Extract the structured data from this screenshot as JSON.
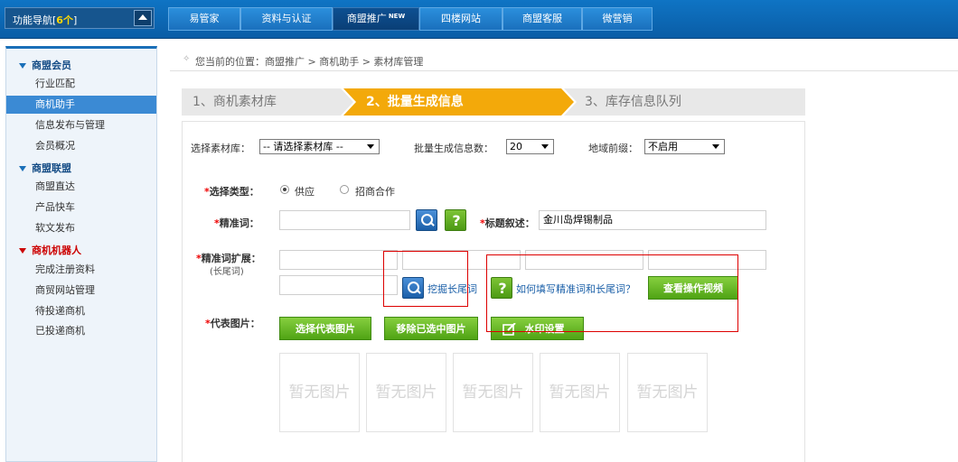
{
  "topbar": {
    "nav_select": {
      "label": "功能导航[",
      "count": "6个",
      "close": "]"
    },
    "tabs": [
      {
        "label": "易管家"
      },
      {
        "label": "资料与认证"
      },
      {
        "label": "商盟推广",
        "badge": "NEW"
      },
      {
        "label": "四楼网站"
      },
      {
        "label": "商盟客服"
      },
      {
        "label": "微营销"
      }
    ]
  },
  "sidebar": {
    "sections": [
      {
        "title": "商盟会员",
        "items": [
          "行业匹配",
          "商机助手",
          "信息发布与管理",
          "会员概况"
        ]
      },
      {
        "title": "商盟联盟",
        "items": [
          "商盟直达",
          "产品快车",
          "软文发布"
        ]
      },
      {
        "title": "商机机器人",
        "items": [
          "完成注册资料",
          "商贸网站管理",
          "待投递商机",
          "已投递商机"
        ]
      }
    ],
    "active_item": "商机助手"
  },
  "breadcrumb": {
    "text": "您当前的位置：商盟推广 > 商机助手 > 素材库管理"
  },
  "steps": [
    {
      "label": "1、商机素材库"
    },
    {
      "label": "2、批量生成信息"
    },
    {
      "label": "3、库存信息队列"
    }
  ],
  "filters": {
    "library_label": "选择素材库：",
    "library_value": "-- 请选择素材库 --",
    "count_label": "批量生成信息数：",
    "count_value": "20",
    "region_label": "地域前缀：",
    "region_value": "不启用"
  },
  "form": {
    "type_label": "选择类型：",
    "type_options": [
      "供应",
      "招商合作"
    ],
    "keyword_label": "精准词：",
    "keyword_value": "",
    "title_label": "标题叙述：",
    "title_value": "金川岛焊锡制品",
    "ext_label": "精准词扩展：",
    "ext_sub_label": "(长尾词)",
    "mine_link": "挖掘长尾词",
    "howto_link": "如何填写精准词和长尾词？",
    "video_button": "查看操作视频",
    "image_label": "代表图片：",
    "choose_image_button": "选择代表图片",
    "remove_image_button": "移除已选中图片",
    "watermark_button": "水印设置",
    "placeholder_text": "暂无图片"
  },
  "colors": {
    "top_bar": "#0a5da6",
    "step_active": "#f3a90a",
    "button_green": "#4fa314",
    "highlight_red": "#dd0000"
  }
}
